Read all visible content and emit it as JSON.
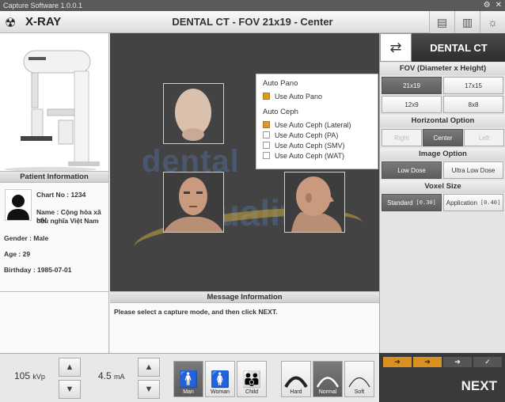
{
  "window": {
    "title": "Capture Software 1.0.0.1"
  },
  "header": {
    "app_label": "X-RAY",
    "mode_title": "DENTAL CT - FOV 21x19 - Center"
  },
  "patient": {
    "section_title": "Patient Information",
    "chart_no": "Chart No : 1234",
    "name_line1": "Name : Cộng hòa xã hội",
    "name_line2": "chủ nghĩa Việt Nam",
    "gender": "Gender : Male",
    "age": "Age : 29",
    "birthday": "Birthday : 1985-07-01"
  },
  "auto_popup": {
    "pano_head": "Auto Pano",
    "pano_option": "Use Auto Pano",
    "ceph_head": "Auto Ceph",
    "ceph_options": [
      {
        "label": "Use Auto Ceph (Lateral)",
        "checked": true
      },
      {
        "label": "Use Auto Ceph (PA)",
        "checked": false
      },
      {
        "label": "Use Auto Ceph (SMV)",
        "checked": false
      },
      {
        "label": "Use Auto Ceph (WAT)",
        "checked": false
      }
    ]
  },
  "watermark": {
    "line1": "dental",
    "line2": "Quality"
  },
  "message": {
    "section_title": "Message Information",
    "text": "Please select a capture mode, and then click NEXT."
  },
  "right": {
    "mode_label": "DENTAL CT",
    "fov_head": "FOV (Diameter x Height)",
    "fov_options": [
      "21x19",
      "17x15",
      "12x9",
      "8x8"
    ],
    "horizontal_head": "Horizontal Option",
    "horizontal_options": [
      "Right",
      "Center",
      "Left"
    ],
    "image_head": "Image Option",
    "image_options": [
      "Low Dose",
      "Ultra Low Dose"
    ],
    "voxel_head": "Voxel Size",
    "voxel_options": [
      {
        "label": "Standard",
        "value": "[0.30]"
      },
      {
        "label": "Application",
        "value": "[0.40]"
      }
    ]
  },
  "bottom": {
    "kvp_value": "105",
    "kvp_unit": "kVp",
    "ma_value": "4.5",
    "ma_unit": "mA",
    "patient_types": [
      "Man",
      "Woman",
      "Child"
    ],
    "arch_types": [
      "Hard",
      "Normal",
      "Soft"
    ]
  },
  "next": {
    "label": "NEXT"
  },
  "colors": {
    "accent": "#d8901f",
    "selected": "#666666",
    "viewer_bg": "#434343"
  }
}
